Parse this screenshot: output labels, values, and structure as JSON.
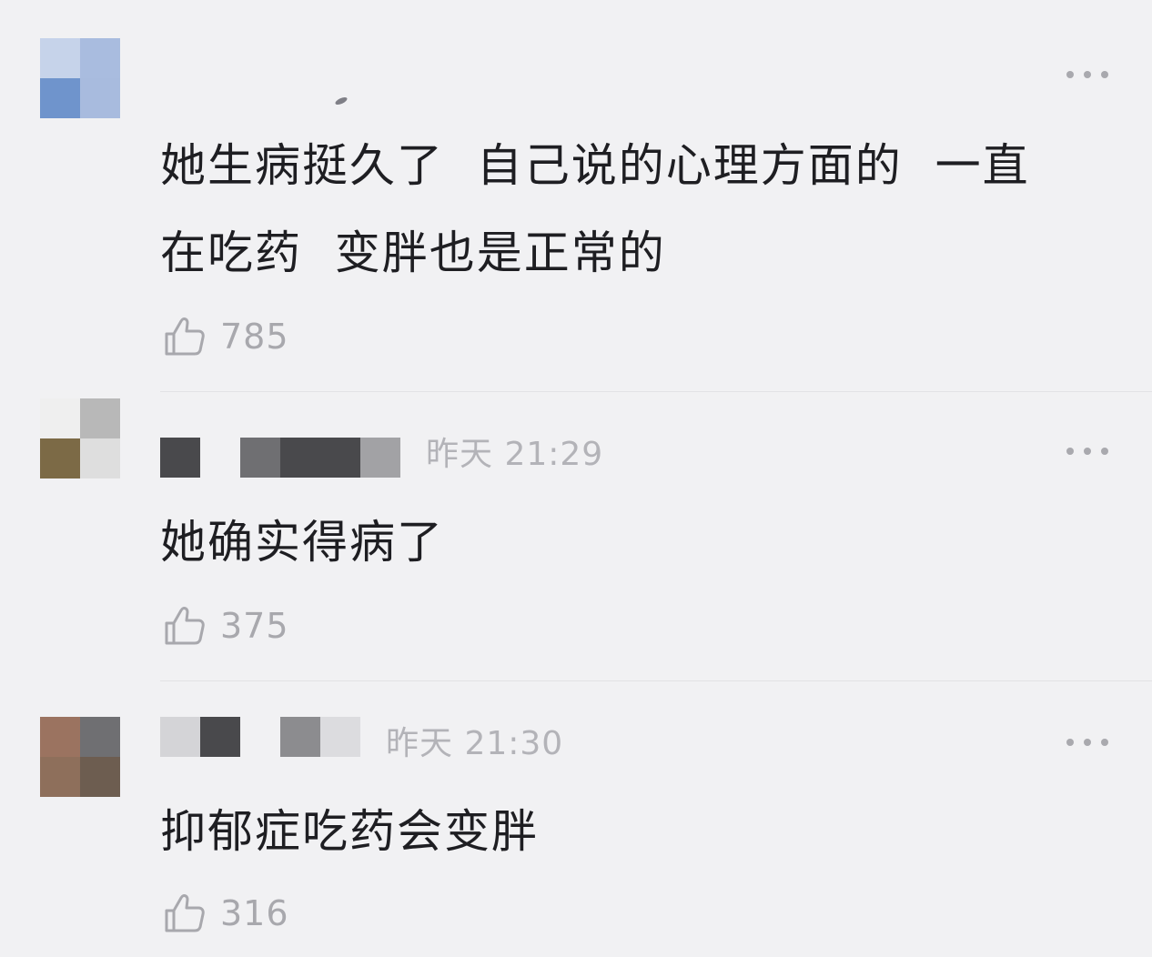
{
  "comments": [
    {
      "username": "",
      "timestamp": "",
      "text": "她生病挺久了  自己说的心理方面的  一直\n在吃药  变胖也是正常的",
      "likes": "785",
      "avatar_colors": [
        "#c6d3ea",
        "#a9bcdf",
        "#6f94cc",
        "#a8bbde"
      ]
    },
    {
      "username": "",
      "timestamp": "昨天 21:29",
      "text": "她确实得病了",
      "likes": "375",
      "avatar_colors": [
        "#efefef",
        "#b8b8b8",
        "#7c6a46",
        "#dedede"
      ]
    },
    {
      "username": "",
      "timestamp": "昨天 21:30",
      "text": "抑郁症吃药会变胖",
      "likes": "316",
      "avatar_colors": [
        "#9b7360",
        "#6f6f72",
        "#8e6f5b",
        "#6d5d50"
      ]
    }
  ],
  "icons": {
    "like": "thumbs-up-outline-icon",
    "more": "more-dots-icon"
  },
  "colors": {
    "background": "#f1f1f3",
    "text": "#1e1e22",
    "muted": "#a8a8ad"
  }
}
